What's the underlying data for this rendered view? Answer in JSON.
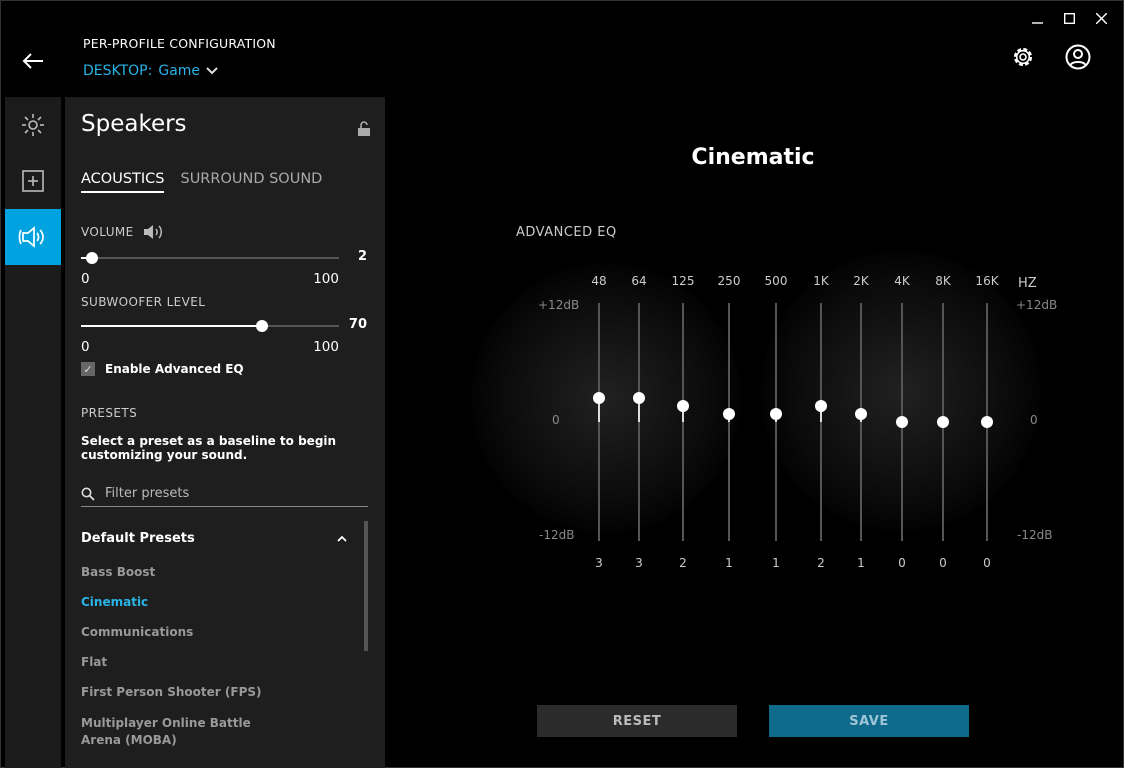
{
  "window": {
    "minimize": "—",
    "maximize": "☐",
    "close": "✕"
  },
  "header": {
    "title": "PER-PROFILE CONFIGURATION",
    "profile_prefix": "DESKTOP:",
    "profile_name": "Game"
  },
  "rail": {
    "items": [
      "lighting-icon",
      "add-icon",
      "speaker-icon"
    ],
    "active_index": 2
  },
  "panel": {
    "title": "Speakers",
    "tabs": [
      {
        "label": "ACOUSTICS",
        "active": true
      },
      {
        "label": "SURROUND SOUND",
        "active": false
      }
    ],
    "volume": {
      "label": "VOLUME",
      "value": "2",
      "value_num": 2,
      "min": "0",
      "max": "100"
    },
    "subwoofer": {
      "label": "SUBWOOFER LEVEL",
      "value": "70",
      "value_num": 70,
      "min": "0",
      "max": "100"
    },
    "advanced_eq": {
      "label": "Enable Advanced EQ",
      "checked": true
    },
    "presets": {
      "heading": "PRESETS",
      "description": "Select a preset as a baseline to begin customizing your sound.",
      "filter_placeholder": "Filter presets",
      "group": "Default Presets",
      "items": [
        "Bass Boost",
        "Cinematic",
        "Communications",
        "Flat",
        "First Person Shooter (FPS)",
        "Multiplayer Online Battle Arena (MOBA)"
      ],
      "active": "Cinematic"
    }
  },
  "main": {
    "preset_name": "Cinematic",
    "eq_title": "ADVANCED EQ",
    "unit": "HZ",
    "db_top": "+12dB",
    "db_mid": "0",
    "db_bottom": "-12dB",
    "bands": [
      {
        "freq": "48",
        "value": "3",
        "gain": 3
      },
      {
        "freq": "64",
        "value": "3",
        "gain": 3
      },
      {
        "freq": "125",
        "value": "2",
        "gain": 2
      },
      {
        "freq": "250",
        "value": "1",
        "gain": 1
      },
      {
        "freq": "500",
        "value": "1",
        "gain": 1
      },
      {
        "freq": "1K",
        "value": "2",
        "gain": 2
      },
      {
        "freq": "2K",
        "value": "1",
        "gain": 1
      },
      {
        "freq": "4K",
        "value": "0",
        "gain": 0
      },
      {
        "freq": "8K",
        "value": "0",
        "gain": 0
      },
      {
        "freq": "16K",
        "value": "0",
        "gain": 0
      }
    ],
    "reset_label": "RESET",
    "save_label": "SAVE"
  }
}
